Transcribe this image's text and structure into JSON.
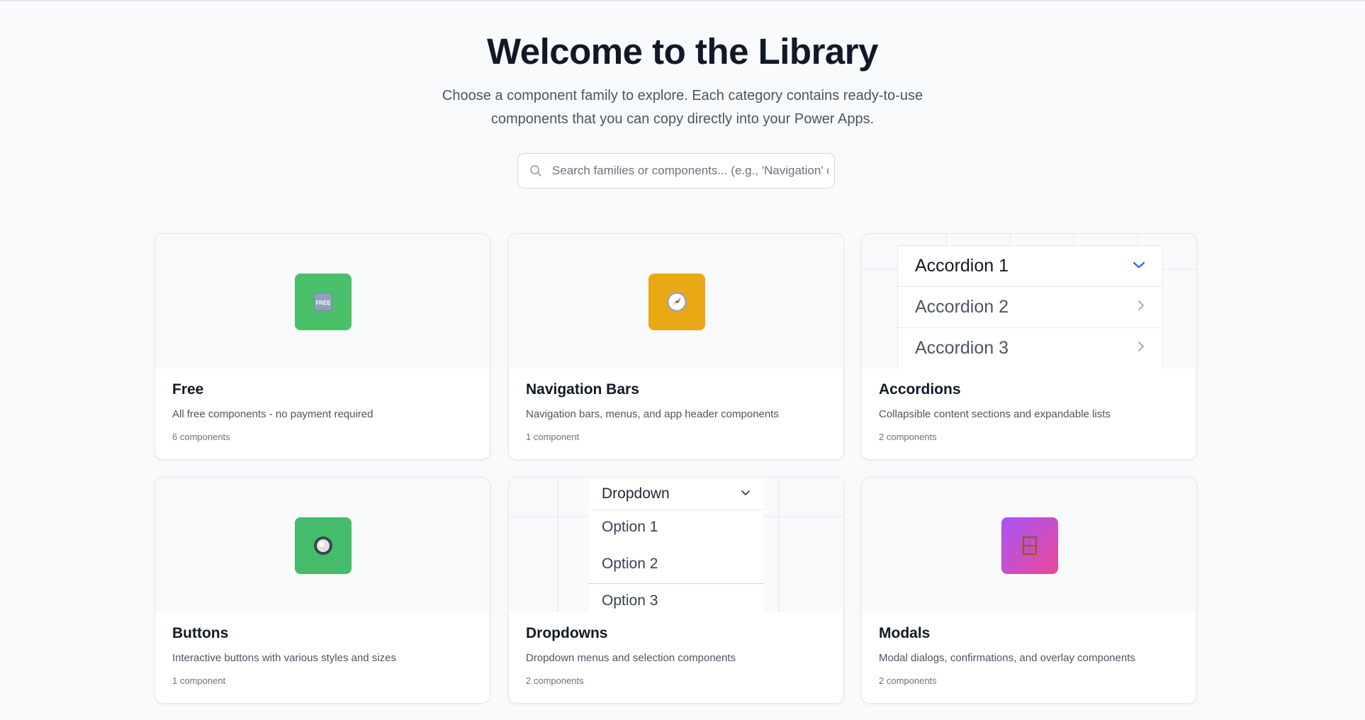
{
  "hero": {
    "title": "Welcome to the Library",
    "subtitle_line1": "Choose a component family to explore. Each category contains ready-to-use",
    "subtitle_line2": "components that you can copy directly into your Power Apps."
  },
  "search": {
    "placeholder": "Search families or components... (e.g., 'Navigation' or"
  },
  "colors": {
    "free_badge": "#4ac06a",
    "nav_badge": "#eaa814",
    "buttons_badge": "#45bb6c",
    "modals_badge_from": "#a855f7",
    "modals_badge_to": "#ec4899",
    "accent_chevron": "#2563eb"
  },
  "cards": [
    {
      "title": "Free",
      "description": "All free components - no payment required",
      "count": "6 components",
      "icon": "free-icon",
      "icon_text": "FREE"
    },
    {
      "title": "Navigation Bars",
      "description": "Navigation bars, menus, and app header components",
      "count": "1 component",
      "icon": "compass-icon"
    },
    {
      "title": "Accordions",
      "description": "Collapsible content sections and expandable lists",
      "count": "2 components",
      "preview_items": [
        "Accordion 1",
        "Accordion 2",
        "Accordion 3"
      ]
    },
    {
      "title": "Buttons",
      "description": "Interactive buttons with various styles and sizes",
      "count": "1 component",
      "icon": "radio-button-icon"
    },
    {
      "title": "Dropdowns",
      "description": "Dropdown menus and selection components",
      "count": "2 components",
      "preview_label": "Dropdown",
      "preview_options": [
        "Option 1",
        "Option 2",
        "Option 3"
      ]
    },
    {
      "title": "Modals",
      "description": "Modal dialogs, confirmations, and overlay components",
      "count": "2 components",
      "icon": "window-icon"
    }
  ]
}
